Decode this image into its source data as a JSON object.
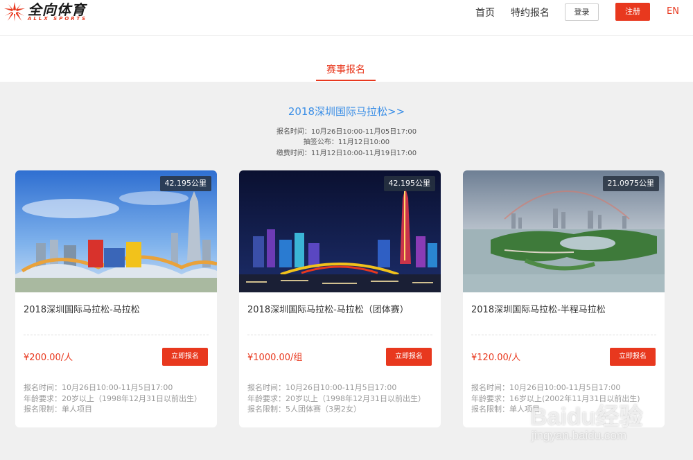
{
  "header": {
    "logo_cn": "全向体育",
    "logo_en": "ALLX SPORTS",
    "nav": [
      "首页",
      "特约报名"
    ],
    "login": "登录",
    "register": "注册",
    "lang": "EN"
  },
  "tab": {
    "label": "赛事报名"
  },
  "event": {
    "title": "2018深圳国际马拉松>>",
    "lines": [
      "报名时间：10月26日10:00-11月05日17:00",
      "抽签公布：11月12日10:00",
      "缴费时间：11月12日10:00-11月19日17:00"
    ]
  },
  "cards": [
    {
      "distance": "42.195公里",
      "name": "2018深圳国际马拉松-马拉松",
      "price": "¥200.00/人",
      "button": "立即报名",
      "info": [
        "报名时间：10月26日10:00-11月5日17:00",
        "年龄要求：20岁以上（1998年12月31日以前出生）",
        "报名限制：单人项目"
      ]
    },
    {
      "distance": "42.195公里",
      "name": "2018深圳国际马拉松-马拉松（团体赛）",
      "price": "¥1000.00/组",
      "button": "立即报名",
      "info": [
        "报名时间：10月26日10:00-11月5日17:00",
        "年龄要求：20岁以上（1998年12月31日以前出生）",
        "报名限制：5人团体赛（3男2女）"
      ]
    },
    {
      "distance": "21.0975公里",
      "name": "2018深圳国际马拉松-半程马拉松",
      "price": "¥120.00/人",
      "button": "立即报名",
      "info": [
        "报名时间：10月26日10:00-11月5日17:00",
        "年龄要求：16岁以上(2002年11月31日以前出生)",
        "报名限制：单人项目"
      ]
    }
  ],
  "watermark": {
    "brand": "Baidu经验",
    "url": "jingyan.baidu.com"
  },
  "colors": {
    "accent": "#e8381e",
    "link": "#3a8ee6",
    "page_bg": "#f0f0f0"
  }
}
